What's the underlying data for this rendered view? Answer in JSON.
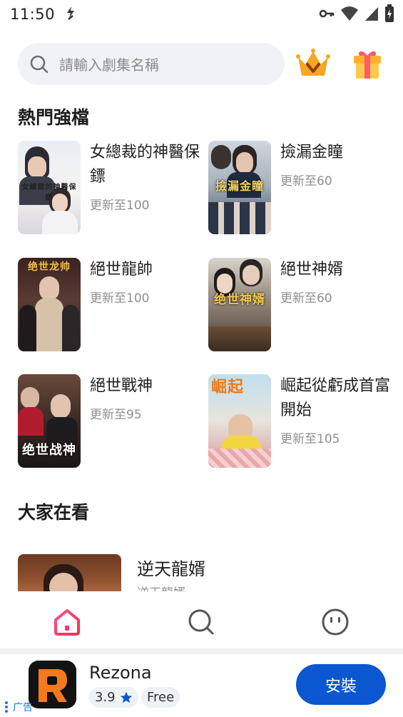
{
  "status_bar": {
    "time": "11:50"
  },
  "search": {
    "placeholder": "請輸入劇集名稱"
  },
  "sections": {
    "hot": "熱門強檔",
    "watching": "大家在看"
  },
  "hot_dramas": [
    {
      "title": "女總裁的神醫保鏢",
      "update": "更新至100",
      "poster_text": "女總裁的神醫保鏢"
    },
    {
      "title": "撿漏金瞳",
      "update": "更新至60",
      "poster_text": "撿漏金瞳"
    },
    {
      "title": "絕世龍帥",
      "update": "更新至100",
      "poster_text": "绝世龙帅"
    },
    {
      "title": "絕世神婿",
      "update": "更新至60",
      "poster_text": "绝世神婿"
    },
    {
      "title": "絕世戰神",
      "update": "更新至95",
      "poster_text": "绝世战神"
    },
    {
      "title": "崛起從虧成首富開始",
      "update": "更新至105",
      "poster_text": "崛起"
    }
  ],
  "watching": [
    {
      "title": "逆天龍婿",
      "subtitle": "逆天龍婿"
    }
  ],
  "bottom_nav": {
    "home_icon": "home-icon",
    "search_icon": "search-icon",
    "profile_icon": "face-icon"
  },
  "ad": {
    "app_name": "Rezona",
    "rating": "3.9",
    "price": "Free",
    "install_label": "安裝",
    "ad_label": "广告"
  },
  "colors": {
    "accent_pink": "#ff2d6f",
    "install_blue": "#0b57d0",
    "crown_gold": "#f5a623"
  }
}
